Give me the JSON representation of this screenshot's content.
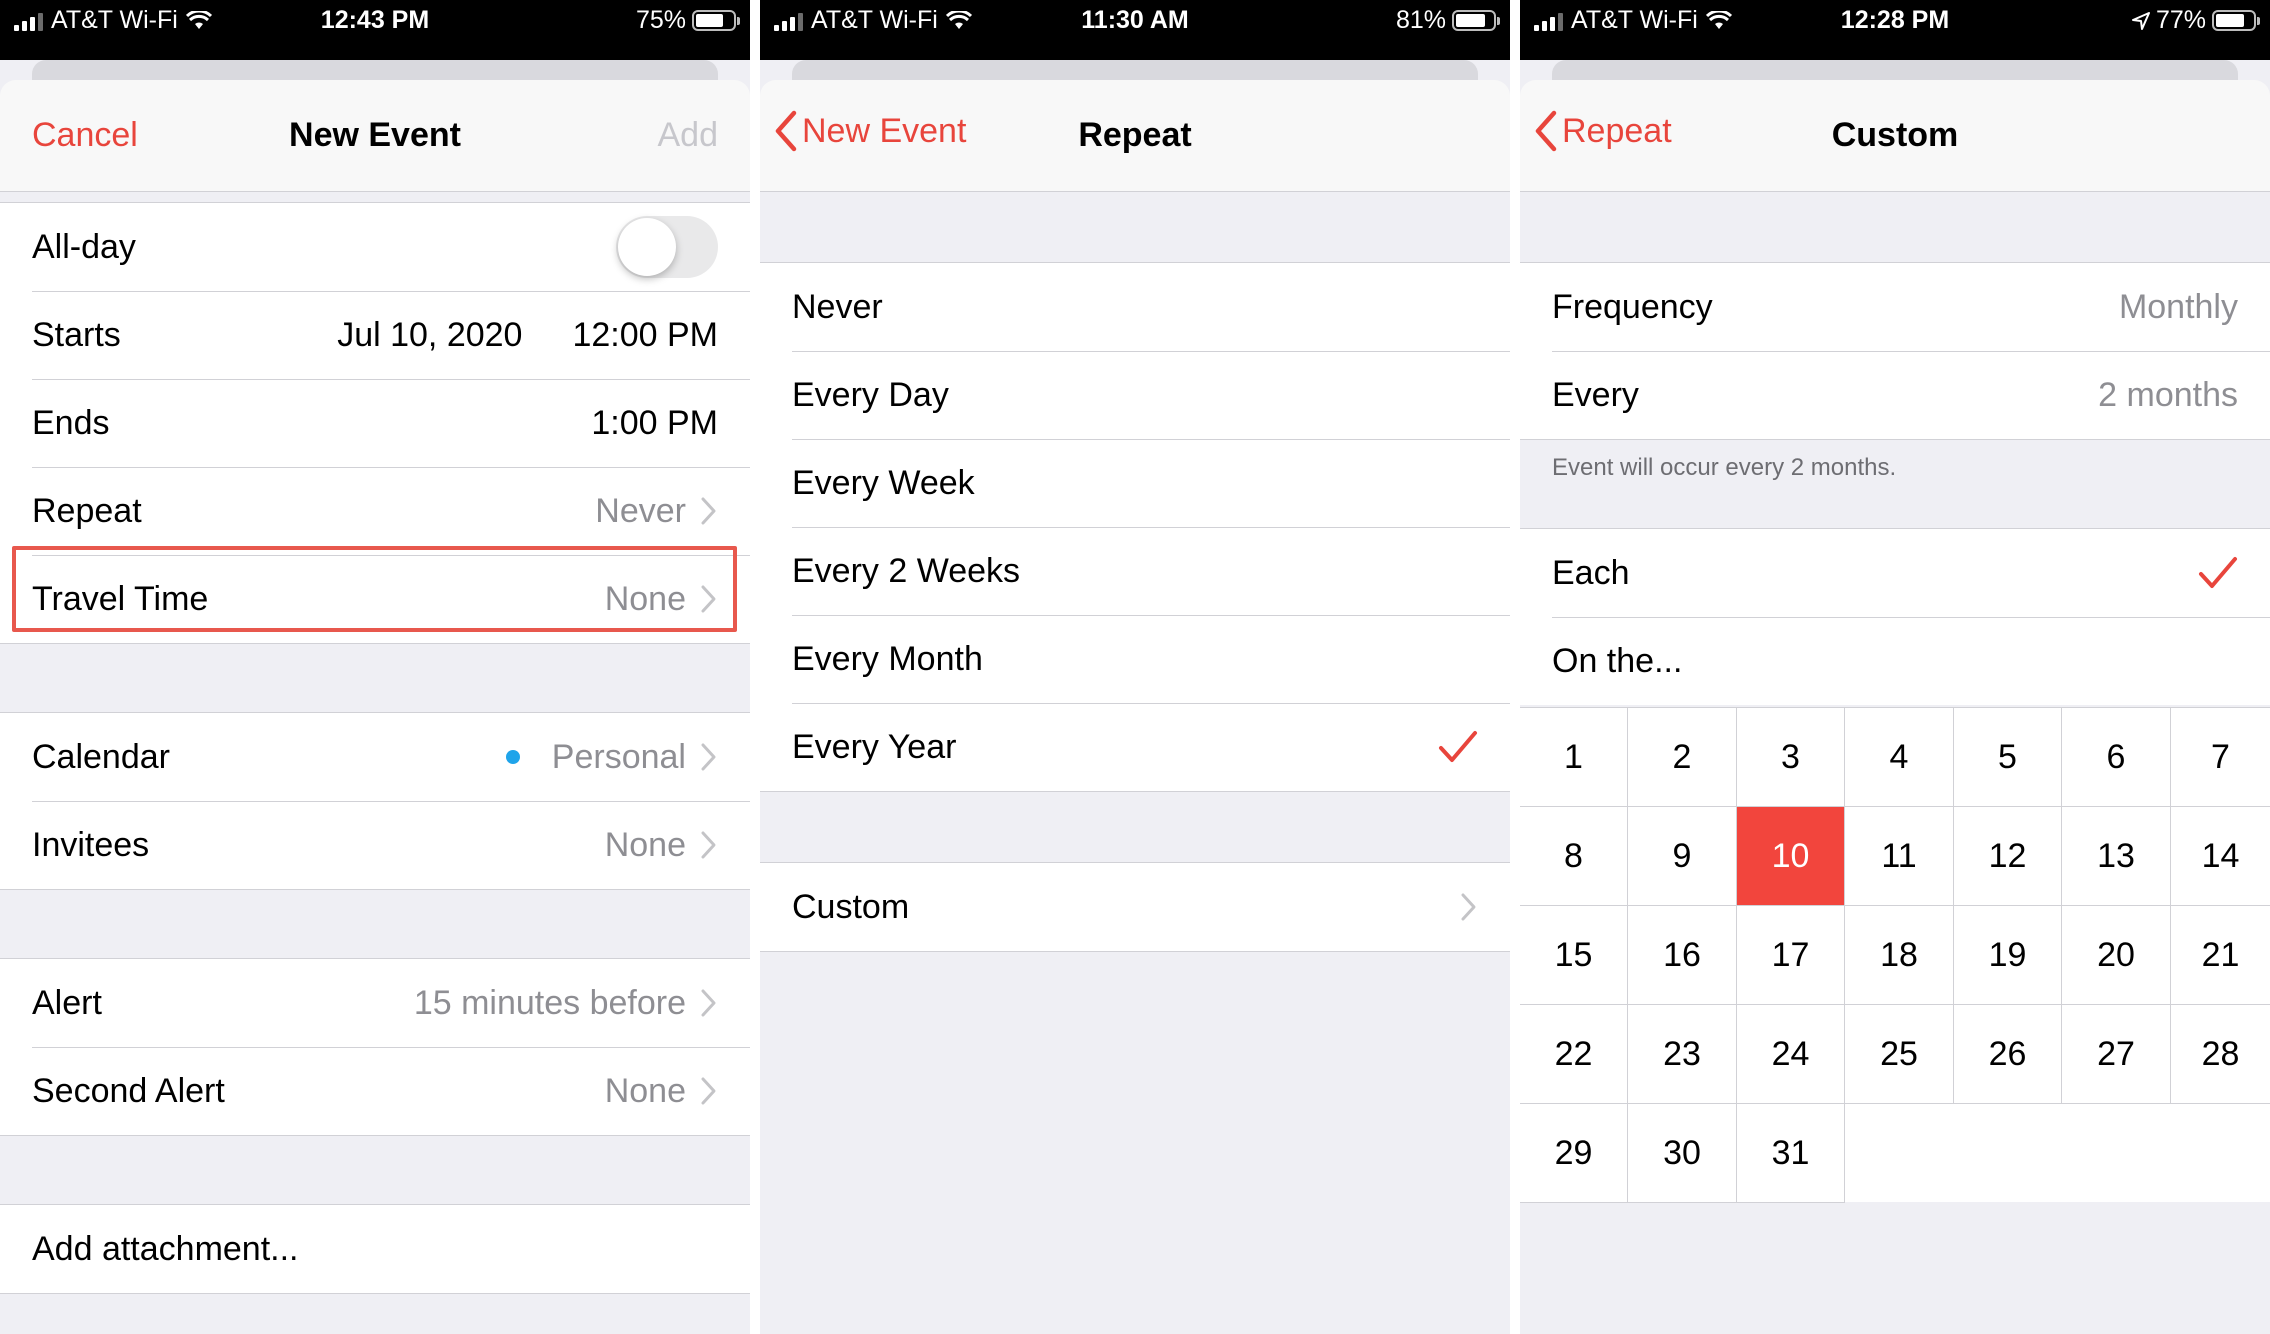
{
  "colors": {
    "accent": "#e8453c",
    "secondary_text": "#8e8e93",
    "selected_day": "#f2453d",
    "highlight_box": "#e8584d",
    "calendar_dot": "#1fa4ea"
  },
  "screens": [
    {
      "status": {
        "carrier": "AT&T Wi-Fi",
        "time": "12:43 PM",
        "battery": "75%"
      },
      "nav": {
        "left": "Cancel",
        "title": "New Event",
        "right": "Add"
      },
      "group1": {
        "allday": "All-day",
        "starts_label": "Starts",
        "starts_date": "Jul 10, 2020",
        "starts_time": "12:00 PM",
        "ends_label": "Ends",
        "ends_time": "1:00 PM",
        "repeat_label": "Repeat",
        "repeat_value": "Never",
        "travel_label": "Travel Time",
        "travel_value": "None"
      },
      "group2": {
        "calendar_label": "Calendar",
        "calendar_value": "Personal",
        "invitees_label": "Invitees",
        "invitees_value": "None"
      },
      "group3": {
        "alert_label": "Alert",
        "alert_value": "15 minutes before",
        "second_alert_label": "Second Alert",
        "second_alert_value": "None"
      },
      "group4": {
        "attachment": "Add attachment..."
      }
    },
    {
      "status": {
        "carrier": "AT&T Wi-Fi",
        "time": "11:30 AM",
        "battery": "81%"
      },
      "nav": {
        "back": "New Event",
        "title": "Repeat"
      },
      "options": [
        "Never",
        "Every Day",
        "Every Week",
        "Every 2 Weeks",
        "Every Month",
        "Every Year"
      ],
      "selected_option": "Every Year",
      "custom": "Custom"
    },
    {
      "status": {
        "carrier": "AT&T Wi-Fi",
        "time": "12:28 PM",
        "battery": "77%"
      },
      "nav": {
        "back": "Repeat",
        "title": "Custom"
      },
      "frequency_label": "Frequency",
      "frequency_value": "Monthly",
      "every_label": "Every",
      "every_value": "2 months",
      "footnote": "Event will occur every 2 months.",
      "each_label": "Each",
      "on_the_label": "On the...",
      "days": [
        "1",
        "2",
        "3",
        "4",
        "5",
        "6",
        "7",
        "8",
        "9",
        "10",
        "11",
        "12",
        "13",
        "14",
        "15",
        "16",
        "17",
        "18",
        "19",
        "20",
        "21",
        "22",
        "23",
        "24",
        "25",
        "26",
        "27",
        "28",
        "29",
        "30",
        "31"
      ],
      "selected_day": "10"
    }
  ]
}
